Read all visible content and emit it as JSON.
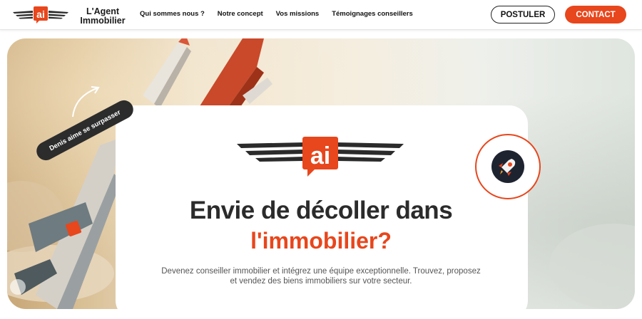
{
  "header": {
    "brand": "L'Agent Immobilier",
    "nav": [
      "Qui sommes nous ?",
      "Notre concept",
      "Vos missions",
      "Témoignages conseillers"
    ],
    "postuler_label": "POSTULER",
    "contact_label": "CONTACT"
  },
  "hero": {
    "tag": "Denis aime se surpasser",
    "headline": "Envie de décoller dans",
    "headline_accent": "l'immobilier?",
    "subtext": "Devenez conseiller immobilier et intégrez une équipe exceptionnelle. Trouvez, proposez et vendez des biens immobiliers sur votre secteur."
  },
  "colors": {
    "accent": "#e8461c",
    "dark": "#2b2b2b"
  }
}
